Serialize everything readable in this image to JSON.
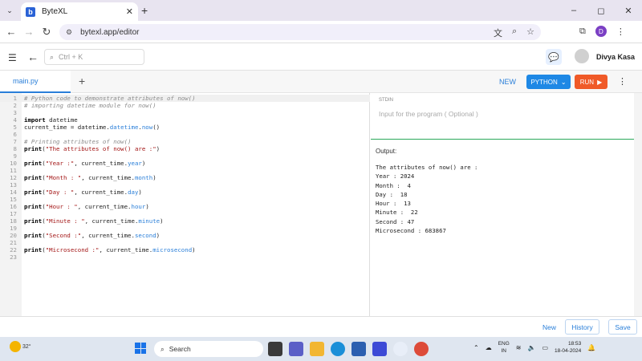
{
  "browser": {
    "tab_title": "ByteXL",
    "tab_favicon": "b",
    "url": "bytexl.app/editor",
    "window_controls": [
      "–",
      "◻",
      "✕"
    ],
    "profile_initial": "D"
  },
  "app": {
    "search_placeholder": "Ctrl + K",
    "user_name": "Divya Kasa"
  },
  "editor": {
    "file_tab": "main.py",
    "new_label": "NEW",
    "language": "PYTHON",
    "run_label": "RUN"
  },
  "code_lines": [
    "# Python code to demonstrate attributes of now()",
    "# importing datetime module for now()",
    "",
    "import datetime",
    "current_time = datetime.datetime.now()",
    "",
    "# Printing attributes of now()",
    "print(\"The attributes of now() are :\")",
    "",
    "print(\"Year :\", current_time.year)",
    "",
    "print(\"Month : \", current_time.month)",
    "",
    "print(\"Day : \", current_time.day)",
    "",
    "print(\"Hour : \", current_time.hour)",
    "",
    "print(\"Minute : \", current_time.minute)",
    "",
    "print(\"Second :\", current_time.second)",
    "",
    "print(\"Microsecond :\", current_time.microsecond)",
    ""
  ],
  "stdin": {
    "label": "STDIN",
    "placeholder": "Input for the program ( Optional )"
  },
  "output": {
    "label": "Output:",
    "text": "The attributes of now() are :\nYear : 2024\nMonth :  4\nDay :  18\nHour :  13\nMinute :  22\nSecond : 47\nMicrosecond : 683867"
  },
  "bottom": {
    "new": "New",
    "history": "History",
    "save": "Save"
  },
  "taskbar": {
    "temperature": "32°",
    "search": "Search",
    "lang_top": "ENG",
    "lang_bottom": "IN",
    "time": "18:53",
    "date": "18-04-2024"
  }
}
